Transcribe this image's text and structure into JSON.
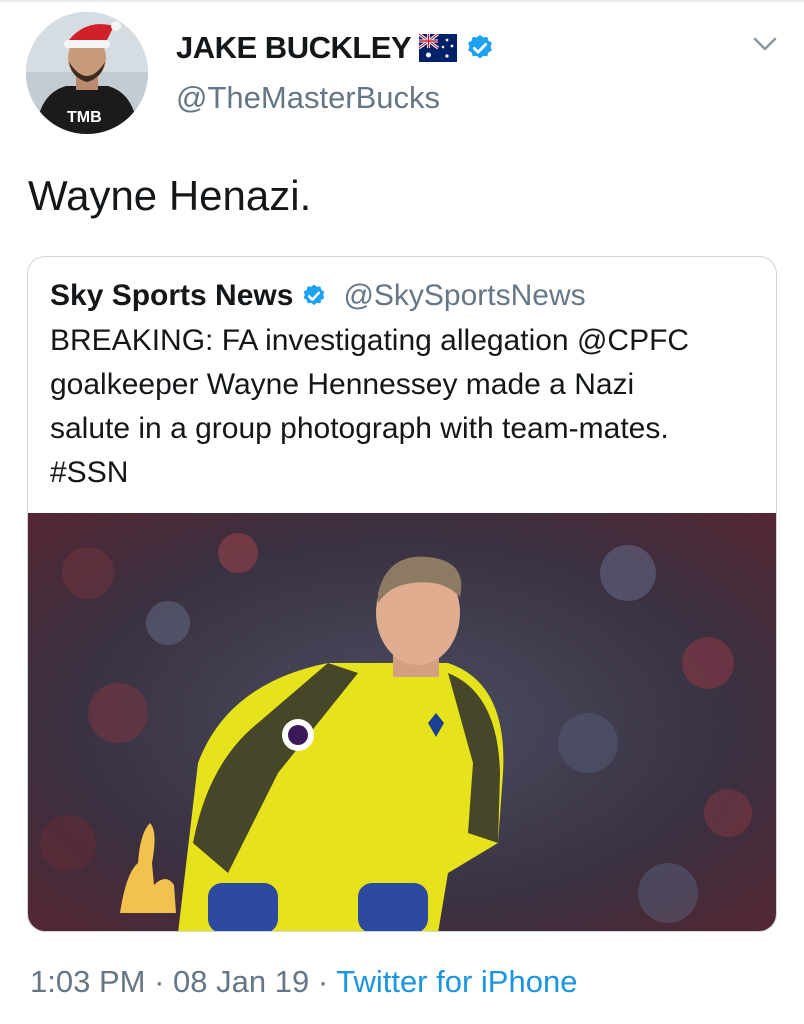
{
  "author": {
    "display_name": "JAKE BUCKLEY",
    "handle": "@TheMasterBucks",
    "avatar_logo_text": "TMB",
    "flag_icon": "australia-flag-icon",
    "verified_icon": "verified-badge-icon"
  },
  "tweet": {
    "text": "Wayne Henazi."
  },
  "quoted_tweet": {
    "display_name": "Sky Sports News",
    "handle": "@SkySportsNews",
    "text_lines": [
      "BREAKING: FA investigating allegation @CPFC",
      "goalkeeper Wayne Hennessey made a Nazi",
      "salute in a group photograph with team-mates.",
      "#SSN"
    ],
    "image_icon": "goalkeeper-photo"
  },
  "footer": {
    "time": "1:03 PM",
    "date": "08 Jan 19",
    "separator": "·",
    "source": "Twitter for iPhone"
  },
  "colors": {
    "text": "#14171a",
    "muted": "#657786",
    "link": "#1b95e0",
    "verified": "#1da1f2",
    "border": "#ccd6dd"
  }
}
